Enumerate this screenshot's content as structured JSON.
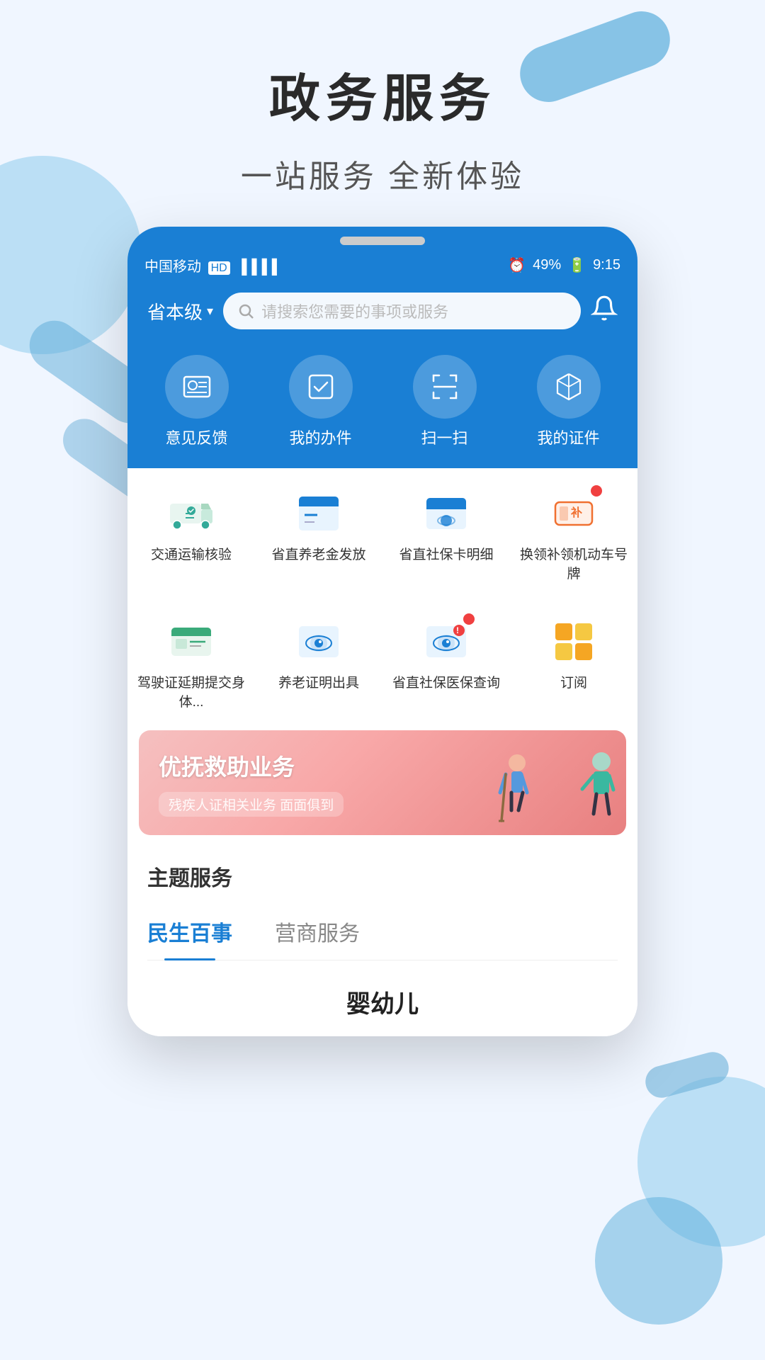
{
  "page": {
    "title": "政务服务",
    "subtitle": "一站服务   全新体验"
  },
  "status_bar": {
    "carrier": "中国移动",
    "hd": "HD",
    "signal": "4G",
    "clock_icon": "⏰",
    "battery_percent": "49%",
    "time": "9:15"
  },
  "header": {
    "region": "省本级",
    "search_placeholder": "请搜索您需要的事项或服务"
  },
  "quick_actions": [
    {
      "id": "feedback",
      "label": "意见反馈",
      "icon": "id-card"
    },
    {
      "id": "my-tasks",
      "label": "我的办件",
      "icon": "checkbox"
    },
    {
      "id": "scan",
      "label": "扫一扫",
      "icon": "scan"
    },
    {
      "id": "my-certs",
      "label": "我的证件",
      "icon": "cube"
    }
  ],
  "services_row1": [
    {
      "id": "transport",
      "label": "交通运输核验",
      "icon": "truck"
    },
    {
      "id": "pension-pay",
      "label": "省直养老金发放",
      "icon": "pension"
    },
    {
      "id": "social-card",
      "label": "省直社保卡明细",
      "icon": "card"
    },
    {
      "id": "plate",
      "label": "换领补领机动车号牌",
      "icon": "plate",
      "badge": true
    }
  ],
  "services_row2": [
    {
      "id": "license-renew",
      "label": "驾驶证延期提交身体...",
      "icon": "license"
    },
    {
      "id": "pension-cert",
      "label": "养老证明出具",
      "icon": "eye-cert"
    },
    {
      "id": "medical-query",
      "label": "省直社保医保查询",
      "icon": "eye-query",
      "badge": true
    },
    {
      "id": "subscribe",
      "label": "订阅",
      "icon": "subscribe"
    }
  ],
  "banner": {
    "title": "优抚救助业务",
    "subtitle": "残疾人证相关业务  面面俱到"
  },
  "theme_section": {
    "title": "主题服务",
    "tabs": [
      {
        "id": "livelihood",
        "label": "民生百事",
        "active": true
      },
      {
        "id": "business",
        "label": "营商服务",
        "active": false
      }
    ]
  },
  "bottom": {
    "category": "婴幼儿"
  }
}
